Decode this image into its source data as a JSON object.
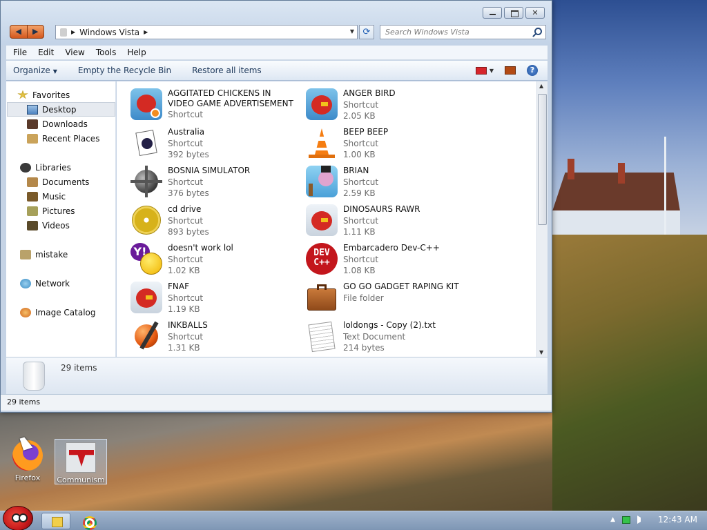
{
  "window": {
    "address": {
      "crumb": "Windows Vista"
    },
    "search": {
      "placeholder": "Search Windows Vista"
    },
    "menu": [
      "File",
      "Edit",
      "View",
      "Tools",
      "Help"
    ],
    "toolbar": {
      "organize": "Organize",
      "empty_bin": "Empty the Recycle Bin",
      "restore_all": "Restore all items"
    },
    "nav": {
      "favorites": "Favorites",
      "desktop": "Desktop",
      "downloads": "Downloads",
      "recent": "Recent Places",
      "libraries": "Libraries",
      "documents": "Documents",
      "music": "Music",
      "pictures": "Pictures",
      "videos": "Videos",
      "mistake": "mistake",
      "network": "Network",
      "image_catalog": "Image Catalog"
    },
    "files": [
      {
        "name": "AGGITATED CHICKENS IN VIDEO GAME ADVERTISEMENT",
        "type": "Shortcut",
        "size": "",
        "icon": "angry-bird-rio-icon"
      },
      {
        "name": "ANGER BIRD",
        "type": "Shortcut",
        "size": "2.05 KB",
        "icon": "angry-bird-icon"
      },
      {
        "name": "Australia",
        "type": "Shortcut",
        "size": "392 bytes",
        "icon": "spider-solitaire-icon"
      },
      {
        "name": "BEEP BEEP",
        "type": "Shortcut",
        "size": "1.00 KB",
        "icon": "vlc-cone-icon"
      },
      {
        "name": "BOSNIA SIMULATOR",
        "type": "Shortcut",
        "size": "376 bytes",
        "icon": "minesweeper-mine-icon"
      },
      {
        "name": "BRIAN",
        "type": "Shortcut",
        "size": "2.59 KB",
        "icon": "angry-bird-slingshot-icon"
      },
      {
        "name": "cd drive",
        "type": "Shortcut",
        "size": "893 bytes",
        "icon": "cd-icon"
      },
      {
        "name": "DINOSAURS RAWR",
        "type": "Shortcut",
        "size": "1.11 KB",
        "icon": "angry-bird-icon"
      },
      {
        "name": "doesn't work lol",
        "type": "Shortcut",
        "size": "1.02 KB",
        "icon": "yahoo-messenger-icon"
      },
      {
        "name": "Embarcadero Dev-C++",
        "type": "Shortcut",
        "size": "1.08 KB",
        "icon": "devcpp-icon"
      },
      {
        "name": "FNAF",
        "type": "Shortcut",
        "size": "1.19 KB",
        "icon": "angry-bird-icon"
      },
      {
        "name": "GO GO GADGET RAPING KIT",
        "type": "File folder",
        "size": "",
        "icon": "briefcase-icon"
      },
      {
        "name": "INKBALLS",
        "type": "Shortcut",
        "size": "1.31 KB",
        "icon": "inkball-icon"
      },
      {
        "name": "loldongs - Copy (2).txt",
        "type": "Text Document",
        "size": "214 bytes",
        "icon": "text-document-icon"
      }
    ],
    "details": {
      "count": "29 items"
    },
    "status": {
      "count": "29 items"
    }
  },
  "desktop": {
    "icons": [
      {
        "label": "Firefox"
      },
      {
        "label": "Communism"
      }
    ]
  },
  "taskbar": {
    "clock": "12:43 AM"
  },
  "colors": {
    "accent": "#1e395b",
    "selection": "#e6eaf0"
  }
}
